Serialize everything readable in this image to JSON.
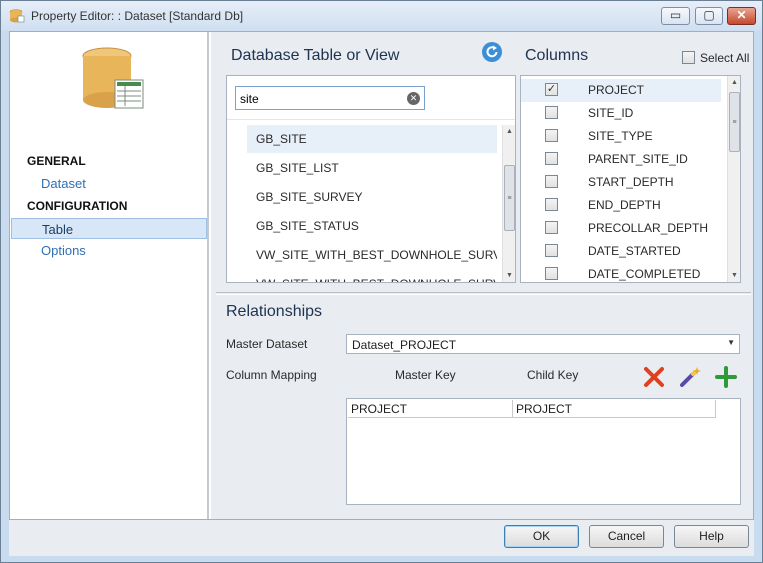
{
  "window": {
    "title": "Property Editor: : Dataset [Standard Db]",
    "controls": {
      "minimize": "▭",
      "maximize": "▢",
      "close": "✕"
    }
  },
  "sidebar": {
    "sections": [
      {
        "header": "GENERAL",
        "items": [
          {
            "label": "Dataset",
            "selected": false
          }
        ]
      },
      {
        "header": "CONFIGURATION",
        "items": [
          {
            "label": "Table",
            "selected": true
          },
          {
            "label": "Options",
            "selected": false
          }
        ]
      }
    ]
  },
  "tables_panel": {
    "title": "Database Table or View",
    "refresh_icon": "refresh-icon",
    "search": {
      "value": "site",
      "clear_icon": "clear-icon"
    },
    "items": [
      {
        "label": "GB_SITE",
        "selected": true
      },
      {
        "label": "GB_SITE_LIST",
        "selected": false
      },
      {
        "label": "GB_SITE_SURVEY",
        "selected": false
      },
      {
        "label": "GB_SITE_STATUS",
        "selected": false
      },
      {
        "label": "VW_SITE_WITH_BEST_DOWNHOLE_SURVEY",
        "selected": false
      },
      {
        "label": "VW_SITE_WITH_BEST_DOWNHOLE_SURVEY",
        "selected": false
      }
    ]
  },
  "columns_panel": {
    "title": "Columns",
    "select_all_label": "Select All",
    "select_all_checked": false,
    "items": [
      {
        "label": "PROJECT",
        "checked": true
      },
      {
        "label": "SITE_ID",
        "checked": false
      },
      {
        "label": "SITE_TYPE",
        "checked": false
      },
      {
        "label": "PARENT_SITE_ID",
        "checked": false
      },
      {
        "label": "START_DEPTH",
        "checked": false
      },
      {
        "label": "END_DEPTH",
        "checked": false
      },
      {
        "label": "PRECOLLAR_DEPTH",
        "checked": false
      },
      {
        "label": "DATE_STARTED",
        "checked": false
      },
      {
        "label": "DATE_COMPLETED",
        "checked": false
      }
    ]
  },
  "relationships": {
    "title": "Relationships",
    "master_dataset_label": "Master Dataset",
    "master_dataset_value": "Dataset_PROJECT",
    "column_mapping_label": "Column Mapping",
    "master_key_header": "Master Key",
    "child_key_header": "Child Key",
    "mappings": [
      {
        "master": "PROJECT",
        "child": "PROJECT"
      }
    ],
    "tools": [
      "delete-icon",
      "magic-wand-icon",
      "add-icon"
    ]
  },
  "footer": {
    "ok": "OK",
    "cancel": "Cancel",
    "help": "Help"
  },
  "colors": {
    "accent": "#2f6fb6",
    "delete": "#e0401f",
    "add": "#2f9a3a",
    "database": "#e8b55a"
  }
}
